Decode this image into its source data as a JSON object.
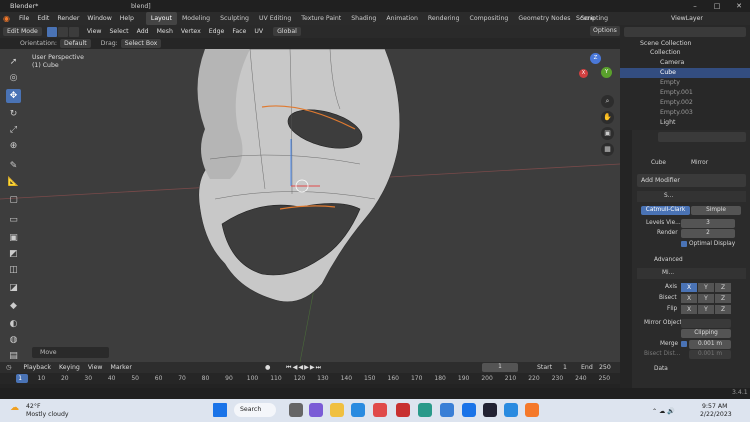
{
  "window": {
    "title": "Blender*",
    "center_title": "blend]",
    "minimize": "–",
    "maximize": "□",
    "close": "✕"
  },
  "menu": {
    "items": [
      "File",
      "Edit",
      "Render",
      "Window",
      "Help"
    ],
    "workspaces": [
      "Layout",
      "Modeling",
      "Sculpting",
      "UV Editing",
      "Texture Paint",
      "Shading",
      "Animation",
      "Rendering",
      "Compositing",
      "Geometry Nodes",
      "Scripting"
    ],
    "scene": "Scene",
    "view_layer": "ViewLayer"
  },
  "vp_header": {
    "mode": "Edit Mode",
    "menus": [
      "View",
      "Select",
      "Add",
      "Mesh",
      "Vertex",
      "Edge",
      "Face",
      "UV"
    ],
    "transform": "Global",
    "options": "Options"
  },
  "vp_header2": {
    "orientation_label": "Orientation:",
    "orientation": "Default",
    "drag_label": "Drag:",
    "drag": "Select Box"
  },
  "viewport": {
    "view_name": "User Perspective",
    "object": "(1) Cube",
    "last_op": "Move"
  },
  "gizmo": {
    "x": "X",
    "y": "Y",
    "z": "Z"
  },
  "timeline": {
    "menus": [
      "Playback",
      "Keying",
      "View",
      "Marker"
    ],
    "current_frame": "1",
    "start_label": "Start",
    "start": "1",
    "end_label": "End",
    "end": "250",
    "ticks": [
      "1",
      "10",
      "20",
      "30",
      "40",
      "50",
      "60",
      "70",
      "80",
      "90",
      "100",
      "110",
      "120",
      "130",
      "140",
      "150",
      "160",
      "170",
      "180",
      "190",
      "200",
      "210",
      "220",
      "230",
      "240",
      "250"
    ]
  },
  "outliner": {
    "root": "Scene Collection",
    "items": [
      {
        "label": "Collection",
        "selected": false
      },
      {
        "label": "Camera",
        "selected": false
      },
      {
        "label": "Cube",
        "selected": true
      },
      {
        "label": "Empty",
        "selected": false
      },
      {
        "label": "Empty.001",
        "selected": false
      },
      {
        "label": "Empty.002",
        "selected": false
      },
      {
        "label": "Empty.003",
        "selected": false
      },
      {
        "label": "Light",
        "selected": false
      }
    ]
  },
  "properties": {
    "object": "Cube",
    "modifier_tab": "Mirror",
    "add_modifier": "Add Modifier",
    "subsurf": {
      "name": "S...",
      "catmull": "Catmull-Clark",
      "simple": "Simple",
      "levels_label": "Levels Vie...",
      "levels": "3",
      "render_label": "Render",
      "render": "2",
      "optimal": "Optimal Display",
      "advanced": "Advanced"
    },
    "mirror": {
      "name": "Mi...",
      "axis_label": "Axis",
      "bisect_label": "Bisect",
      "flip_label": "Flip",
      "x": "X",
      "y": "Y",
      "z": "Z",
      "mirror_object_label": "Mirror Object",
      "clipping": "Clipping",
      "merge_label": "Merge",
      "merge": "0.001 m",
      "bisect_dist_label": "Bisect Dist...",
      "bisect_dist": "0.001 m",
      "data": "Data"
    }
  },
  "status": {
    "version": "3.4.1"
  },
  "taskbar": {
    "weather_temp": "42°F",
    "weather_desc": "Mostly cloudy",
    "search": "Search",
    "time": "9:57 AM",
    "date": "2/22/2023"
  }
}
